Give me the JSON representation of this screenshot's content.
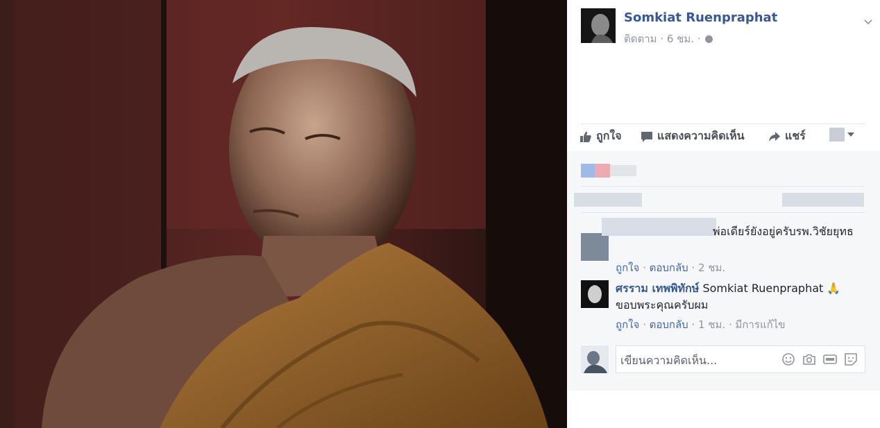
{
  "post": {
    "author": "Somkiat Ruenpraphat",
    "follow_label": "ติดตาม",
    "time": "6 ชม.",
    "sep": "·"
  },
  "actions": {
    "like": "ถูกใจ",
    "comment": "แสดงความคิดเห็น",
    "share": "แชร์"
  },
  "comments": [
    {
      "text": "พ่อเดียร์ยังอยู่ครับรพ.วิชัยยุทธ",
      "like": "ถูกใจ",
      "reply": "ตอบกลับ",
      "time": "2 ชม."
    },
    {
      "name": "ศรราม เทพพิทักษ์",
      "text": "Somkiat Ruenpraphat 🙏 ขอบพระคุณครับผม",
      "like": "ถูกใจ",
      "reply": "ตอบกลับ",
      "time": "1 ชม.",
      "edited": "มีการแก้ไข"
    }
  ],
  "composer": {
    "placeholder": "เขียนความคิดเห็น..."
  },
  "icons": {
    "like": "thumbs-up-icon",
    "comment": "speech-bubble-icon",
    "share": "share-arrow-icon",
    "audience": "chevron-down-icon",
    "globe": "globe-icon",
    "emoji": "emoji-icon",
    "camera": "camera-icon",
    "gif": "gif-icon",
    "sticker": "sticker-icon"
  },
  "colors": {
    "link": "#365899",
    "muted": "#90949c",
    "feedback_bg": "#f6f7f9"
  }
}
